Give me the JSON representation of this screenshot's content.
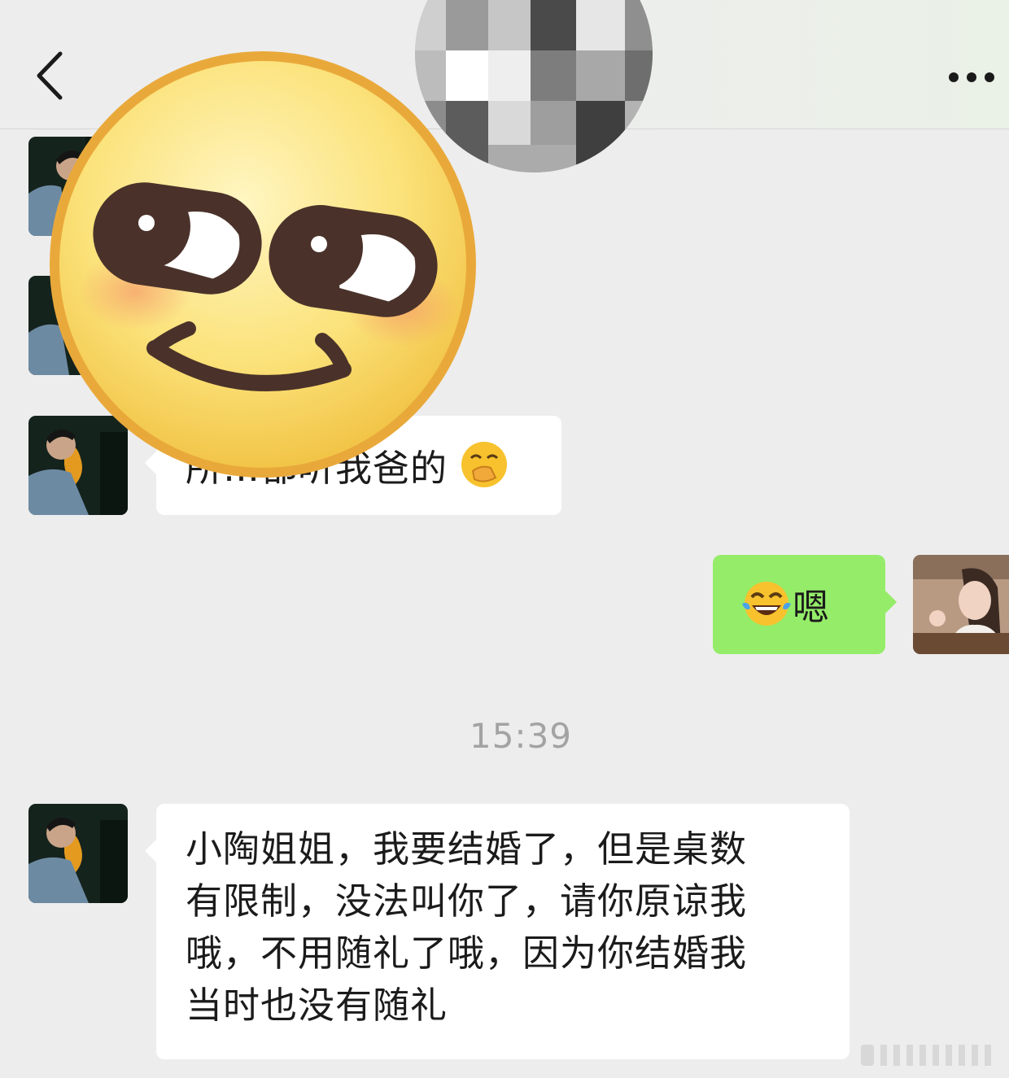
{
  "header": {
    "back_icon": "chevron-left-icon",
    "more_icon": "more-dots-icon",
    "avatar": "pixelated-avatar"
  },
  "overlay": {
    "sticker": "smirk-face-emoji-sticker"
  },
  "messages": [
    {
      "side": "left",
      "text": "所…都听我爸的",
      "emoji": "hand-over-mouth-emoji"
    },
    {
      "side": "right",
      "text": "嗯",
      "emoji": "tears-of-joy-emoji"
    },
    {
      "side": "left",
      "lines": [
        "小陶姐姐，我要结婚了，但是桌数",
        "有限制，没法叫你了，请你原谅我",
        "哦，不用随礼了哦，因为你结婚我",
        "当时也没有随礼"
      ]
    }
  ],
  "timestamp": "15:39",
  "colors": {
    "background": "#ededed",
    "bubble_left": "#ffffff",
    "bubble_right": "#95ec69",
    "timestamp": "#a3a3a3"
  }
}
